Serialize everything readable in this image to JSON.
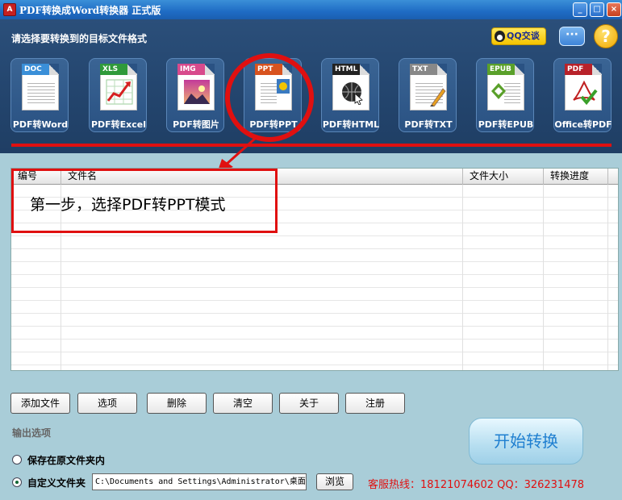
{
  "window": {
    "title": "PDF转换成Word转换器 正式版",
    "app_icon": "A"
  },
  "header": {
    "label": "请选择要转换到的目标文件格式",
    "qq_button": "QQ交谈",
    "chat_glyph": "···",
    "help_glyph": "?"
  },
  "formats": [
    {
      "badge": "DOC",
      "label": "PDF转Word",
      "color": "#3a8fd8"
    },
    {
      "badge": "XLS",
      "label": "PDF转Excel",
      "color": "#2f9a3a"
    },
    {
      "badge": "IMG",
      "label": "PDF转图片",
      "color": "#d84a8c"
    },
    {
      "badge": "PPT",
      "label": "PDF转PPT",
      "color": "#d8531f"
    },
    {
      "badge": "HTML",
      "label": "PDF转HTML",
      "color": "#222222"
    },
    {
      "badge": "TXT",
      "label": "PDF转TXT",
      "color": "#888888"
    },
    {
      "badge": "EPUB",
      "label": "PDF转EPUB",
      "color": "#5aa02a"
    },
    {
      "badge": "PDF",
      "label": "Office转PDF",
      "color": "#b8222a"
    }
  ],
  "table": {
    "columns": [
      "编号",
      "文件名",
      "文件大小",
      "转换进度"
    ],
    "rows": []
  },
  "annotation": {
    "step_text": "第一步，选择PDF转PPT模式"
  },
  "buttons": {
    "add": "添加文件",
    "options": "选项",
    "delete": "删除",
    "clear": "清空",
    "about": "关于",
    "register": "注册"
  },
  "output": {
    "section_title": "输出选项",
    "option_original": "保存在原文件夹内",
    "option_custom": "自定义文件夹",
    "selected": "custom",
    "path": "C:\\Documents and Settings\\Administrator\\桌面",
    "browse": "浏览"
  },
  "hotline": "客服热线：18121074602 QQ：326231478",
  "start_button": "开始转换",
  "colors": {
    "accent_red": "#e01010",
    "header_bg": "#24466f",
    "body_bg": "#a9cdd8"
  }
}
